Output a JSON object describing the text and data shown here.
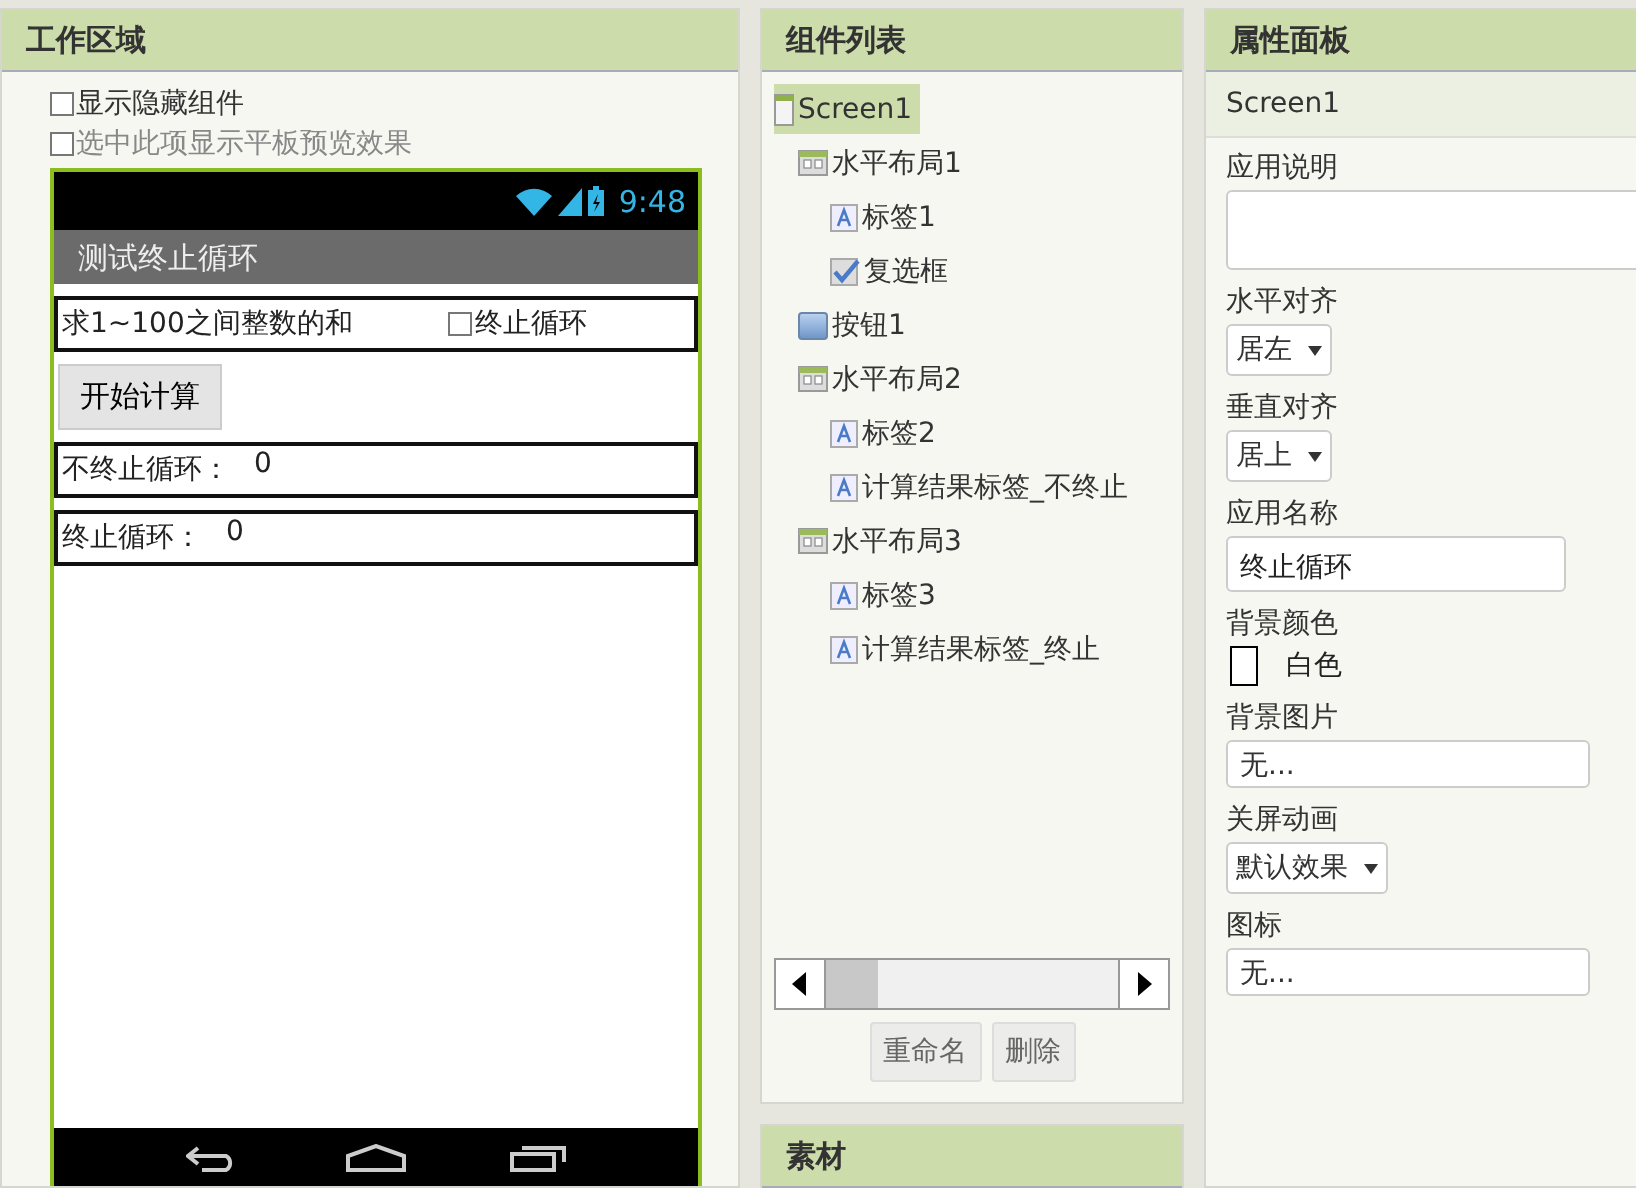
{
  "workspace": {
    "title": "工作区域",
    "options": [
      {
        "label": "显示隐藏组件",
        "checked": false,
        "disabled": false
      },
      {
        "label": "选中此项显示平板预览效果",
        "checked": false,
        "disabled": true
      }
    ],
    "phone": {
      "time": "9:48",
      "app_title": "测试终止循环",
      "rows": [
        {
          "kind": "label-checkbox",
          "label": "求1~100之间整数的和",
          "checkbox": "终止循环",
          "checked": false
        },
        {
          "kind": "button",
          "label": "开始计算"
        },
        {
          "kind": "result",
          "label": "不终止循环：",
          "value": "0"
        },
        {
          "kind": "result",
          "label": "终止循环：",
          "value": "0"
        }
      ]
    }
  },
  "components": {
    "title": "组件列表",
    "tree": [
      {
        "kind": "screen",
        "label": "Screen1",
        "selected": true,
        "children": [
          {
            "kind": "arrangement",
            "label": "水平布局1",
            "selected": false,
            "children": [
              {
                "kind": "label",
                "label": "标签1",
                "selected": false
              },
              {
                "kind": "checkbox",
                "label": "复选框",
                "selected": false
              }
            ]
          },
          {
            "kind": "button",
            "label": "按钮1",
            "selected": false
          },
          {
            "kind": "arrangement",
            "label": "水平布局2",
            "selected": false,
            "children": [
              {
                "kind": "label",
                "label": "标签2",
                "selected": false
              },
              {
                "kind": "label",
                "label": "计算结果标签_不终止",
                "selected": false
              }
            ]
          },
          {
            "kind": "arrangement",
            "label": "水平布局3",
            "selected": false,
            "children": [
              {
                "kind": "label",
                "label": "标签3",
                "selected": false
              },
              {
                "kind": "label",
                "label": "计算结果标签_终止",
                "selected": false
              }
            ]
          }
        ]
      }
    ],
    "buttons": [
      "重命名",
      "删除"
    ]
  },
  "media": {
    "title": "素材"
  },
  "properties": {
    "title": "属性面板",
    "component": "Screen1",
    "items": [
      {
        "kind": "textarea",
        "label": "应用说明"
      },
      {
        "kind": "dropdown",
        "label": "水平对齐",
        "value": "居左"
      },
      {
        "kind": "dropdown",
        "label": "垂直对齐",
        "value": "居上"
      },
      {
        "kind": "text",
        "label": "应用名称",
        "value": "终止循环"
      },
      {
        "kind": "color",
        "label": "背景颜色",
        "value": "白色",
        "color": "#ffffff"
      },
      {
        "kind": "asset",
        "label": "背景图片",
        "value": "无..."
      },
      {
        "kind": "dropdown",
        "label": "关屏动画",
        "value": "默认效果"
      },
      {
        "kind": "asset",
        "label": "图标",
        "value": "无..."
      }
    ]
  }
}
